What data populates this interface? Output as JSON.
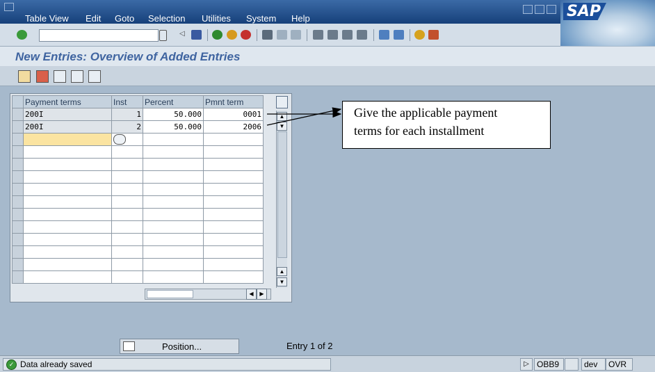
{
  "menu": [
    "Table View",
    "Edit",
    "Goto",
    "Selection",
    "Utilities",
    "System",
    "Help"
  ],
  "logo": "SAP",
  "title": "New Entries: Overview of Added Entries",
  "table": {
    "headers": [
      "Payment terms",
      "Inst",
      "Percent",
      "Pmnt term"
    ],
    "rows": [
      [
        "200I",
        "1",
        "50.000",
        "0001"
      ],
      [
        "200I",
        "2",
        "50.000",
        "2006"
      ]
    ]
  },
  "callout": {
    "line1": "Give the applicable payment",
    "line2": "terms for each installment"
  },
  "position_button": "Position...",
  "entry_info": "Entry 1 of 2",
  "status": {
    "message": "Data already saved",
    "transaction": "OBB9",
    "system": "dev",
    "mode": "OVR"
  }
}
